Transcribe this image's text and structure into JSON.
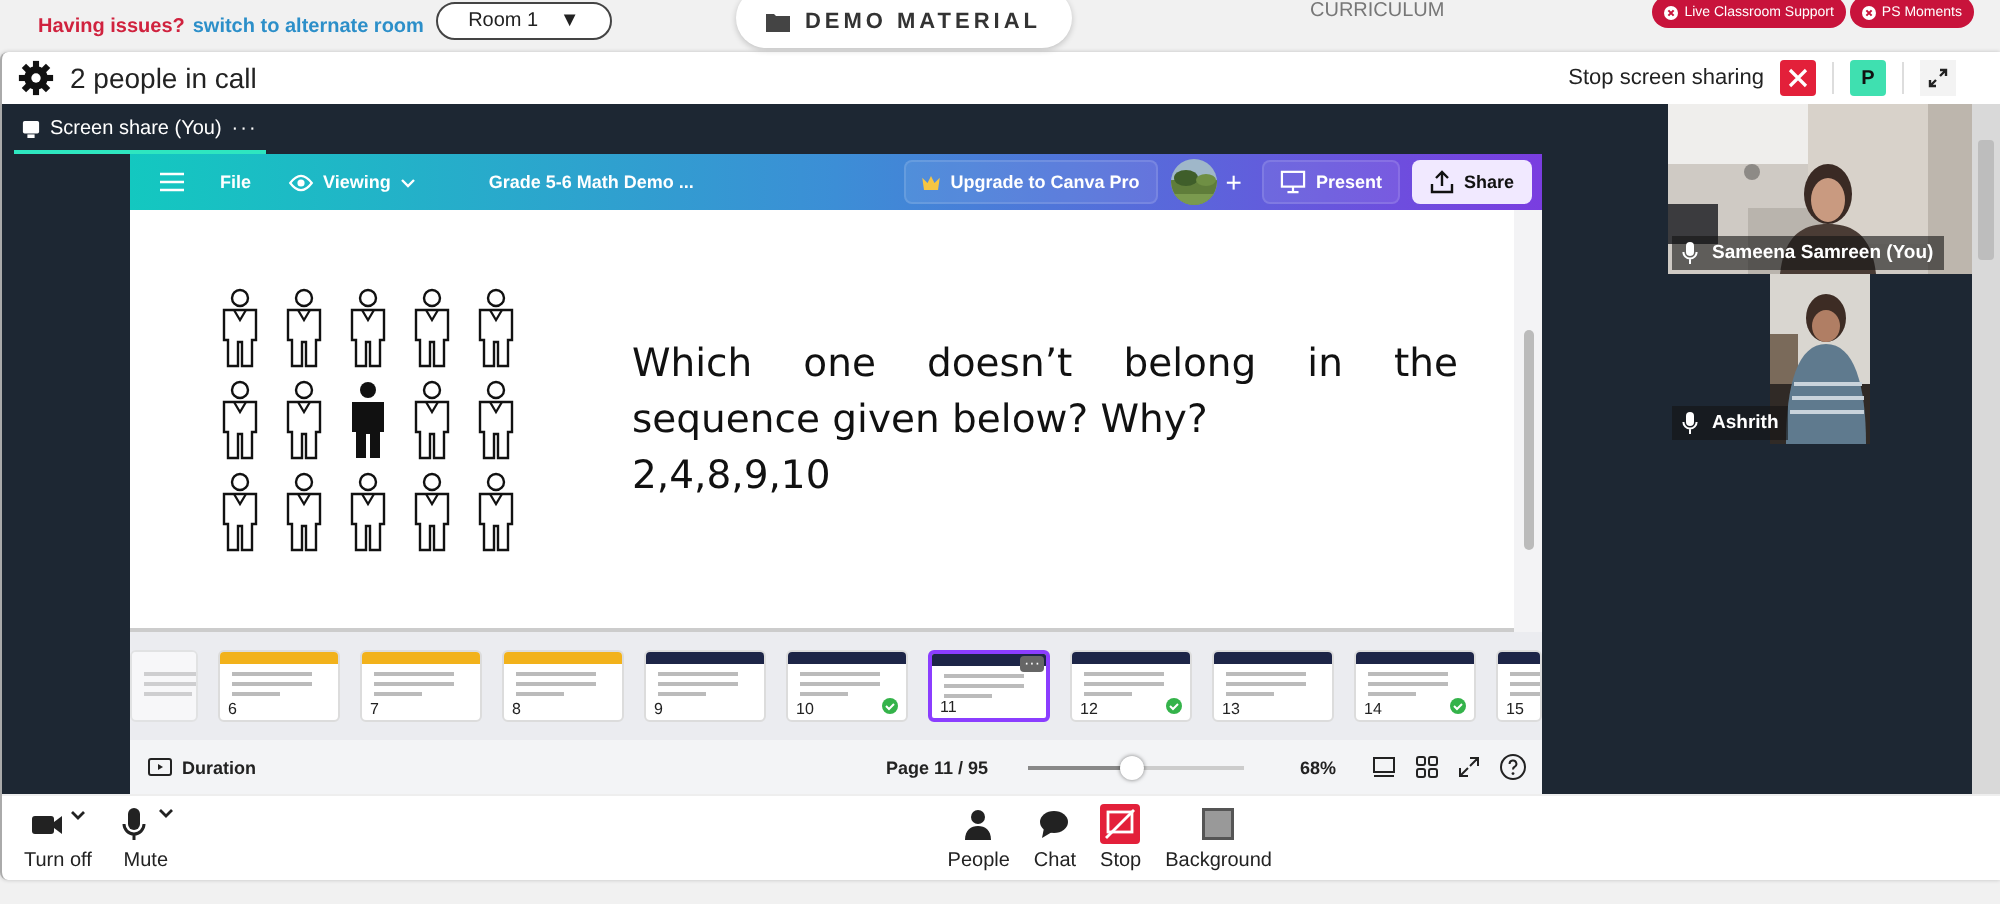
{
  "topbar": {
    "issue_text": "Having issues?",
    "switch_link": "switch to alternate room",
    "room_select": "Room 1",
    "room_caret": "▼",
    "demo_button": "DEMO MATERIAL",
    "curriculum": "CURRICULUM",
    "pills": [
      "Live Classroom Support",
      "PS Moments"
    ]
  },
  "call_header": {
    "title": "2 people in call",
    "stop_sharing": "Stop screen sharing",
    "avatar_letter": "P"
  },
  "share_tab": {
    "label": "Screen share (You)",
    "more": "···"
  },
  "canva_toolbar": {
    "file": "File",
    "viewing": "Viewing",
    "doc_title": "Grade 5-6 Math Demo ...",
    "upgrade": "Upgrade to Canva Pro",
    "plus": "+",
    "present": "Present",
    "share": "Share"
  },
  "slide": {
    "figures": [
      [
        {
          "filled": false
        },
        {
          "filled": false
        },
        {
          "filled": false
        },
        {
          "filled": false
        },
        {
          "filled": false
        }
      ],
      [
        {
          "filled": false
        },
        {
          "filled": false
        },
        {
          "filled": true
        },
        {
          "filled": false
        },
        {
          "filled": false
        }
      ],
      [
        {
          "filled": false
        },
        {
          "filled": false
        },
        {
          "filled": false
        },
        {
          "filled": false
        },
        {
          "filled": false
        }
      ]
    ],
    "question": "Which one doesn’t belong in the sequence given below? Why?",
    "sequence": "2,4,8,9,10"
  },
  "thumbnails": [
    {
      "color": "#ffffff",
      "selected": false,
      "checked": false
    },
    {
      "number": "6",
      "color": "#f2b21b",
      "selected": false,
      "checked": false
    },
    {
      "number": "7",
      "color": "#f2b21b",
      "selected": false,
      "checked": false
    },
    {
      "number": "8",
      "color": "#f2b21b",
      "selected": false,
      "checked": false
    },
    {
      "number": "9",
      "color": "#1d2547",
      "selected": false,
      "checked": false
    },
    {
      "number": "10",
      "color": "#1d2547",
      "selected": false,
      "checked": true
    },
    {
      "number": "11",
      "color": "#1d2547",
      "selected": true,
      "checked": false,
      "menu": "···"
    },
    {
      "number": "12",
      "color": "#1d2547",
      "selected": false,
      "checked": true
    },
    {
      "number": "13",
      "color": "#1d2547",
      "selected": false,
      "checked": false
    },
    {
      "number": "14",
      "color": "#1d2547",
      "selected": false,
      "checked": true
    },
    {
      "number": "15",
      "color": "#1d2547",
      "selected": false,
      "checked": false
    }
  ],
  "canva_footer": {
    "duration": "Duration",
    "page": "Page 11 / 95",
    "zoom": {
      "level": 0.48
    },
    "zoom_reading": "68%"
  },
  "participants": [
    {
      "name": "Sameena Samreen (You)"
    },
    {
      "name": "Ashrith"
    }
  ],
  "controls": [
    {
      "kind": "camera",
      "label": "Turn off"
    },
    {
      "kind": "mic",
      "label": "Mute"
    },
    {
      "kind": "people",
      "label": "People"
    },
    {
      "kind": "chat",
      "label": "Chat"
    },
    {
      "kind": "stop",
      "label": "Stop"
    },
    {
      "kind": "background",
      "label": "Background"
    }
  ]
}
